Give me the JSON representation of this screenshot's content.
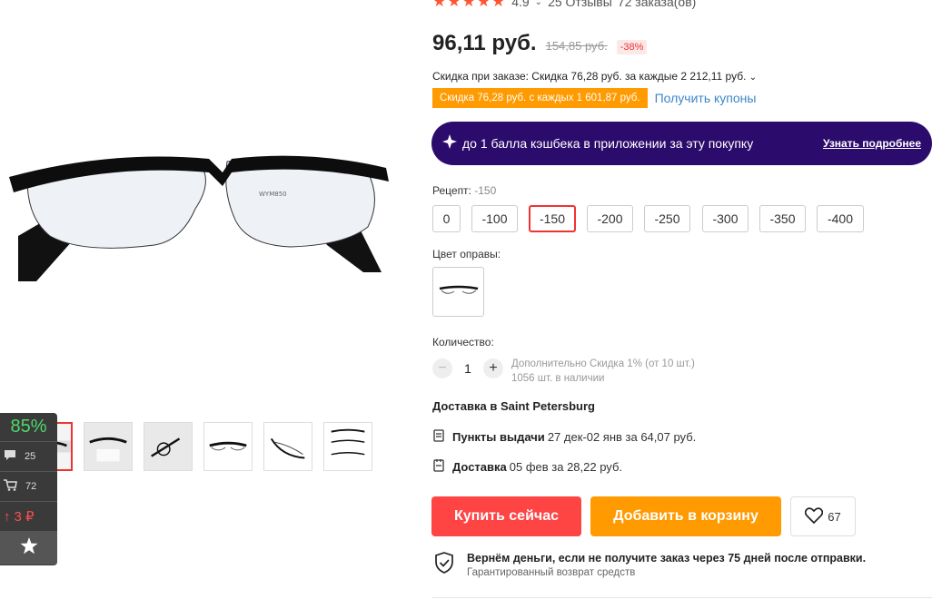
{
  "rating": {
    "score": "4.9",
    "reviews": "25 Отзывы",
    "orders": "72 заказа(ов)"
  },
  "price": {
    "current": "96,11 руб.",
    "old": "154,85 руб.",
    "discount": "-38%"
  },
  "order_discount": "Скидка при заказе: Скидка 76,28 руб. за каждые 2 212,11 руб.",
  "coupon": {
    "text": "Скидка 76,28 руб. с каждых 1 601,87 руб.",
    "link": "Получить купоны"
  },
  "cashback": {
    "text": "до 1 балла кэшбека в приложении за эту покупку",
    "link": "Узнать подробнее"
  },
  "recipe": {
    "label": "Рецепт:",
    "selected": "-150",
    "options": [
      "0",
      "-100",
      "-150",
      "-200",
      "-250",
      "-300",
      "-350",
      "-400"
    ]
  },
  "frame": {
    "label": "Цвет оправы:"
  },
  "quantity": {
    "label": "Количество:",
    "value": "1",
    "extra_discount": "Дополнительно Скидка 1% (от 10 шт.)",
    "stock": "1056 шт. в наличии"
  },
  "shipping": {
    "title": "Доставка в Saint Petersburg",
    "pickup_label": "Пункты выдачи",
    "pickup_text": "27 дек-02 янв за 64,07 руб.",
    "delivery_label": "Доставка",
    "delivery_text": "05 фев за 28,22 руб."
  },
  "actions": {
    "buy": "Купить сейчас",
    "cart": "Добавить в корзину",
    "wishlist_count": "67"
  },
  "guarantee": {
    "title": "Вернём деньги, если не получите заказ через 75 дней после отправки.",
    "subtitle": "Гарантированный возврат средств"
  },
  "widget": {
    "percent": "85%",
    "comments": "25",
    "cart": "72",
    "price_change": "3 ₽"
  },
  "colors": {
    "accent_red": "#ff4444",
    "orange": "#ff9a00",
    "cashback_bg": "#2b0b6b",
    "link_blue": "#3c86c8"
  }
}
